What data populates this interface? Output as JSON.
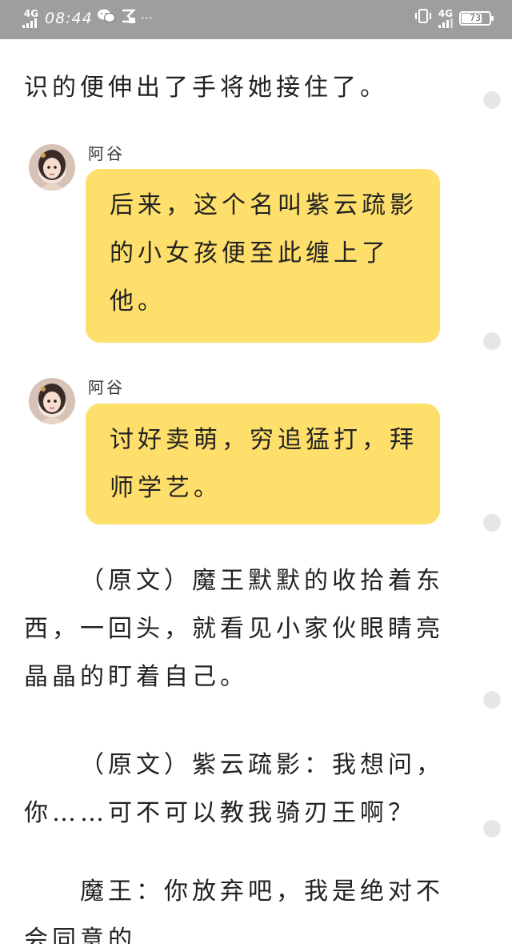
{
  "status_bar": {
    "network_left": "4G",
    "time": "08:44",
    "icons_left": [
      "signal-icon",
      "wechat-icon",
      "data-saver-icon",
      "more-icon"
    ],
    "more": "···",
    "network_right": "4G",
    "battery": "73",
    "battery_level": 0.73
  },
  "article": {
    "top_paragraph": "识的便伸出了手将她接住了。",
    "messages": [
      {
        "speaker": "阿谷",
        "text": "后来，这个名叫紫云疏影的小女孩便至此缠上了他。"
      },
      {
        "speaker": "阿谷",
        "text": "讨好卖萌，穷追猛打，拜师学艺。"
      }
    ],
    "paragraphs": [
      "（原文）魔王默默的收拾着东西，一回头，就看见小家伙眼睛亮晶晶的盯着自己。",
      "（原文）紫云疏影：我想问，你……可不可以教我骑刃王啊？",
      "魔王：你放弃吧，我是绝对不会同意的"
    ]
  },
  "colors": {
    "bubble": "#fedf6b",
    "status_bar": "#787878",
    "scroll_dot": "#e6e6e6"
  }
}
